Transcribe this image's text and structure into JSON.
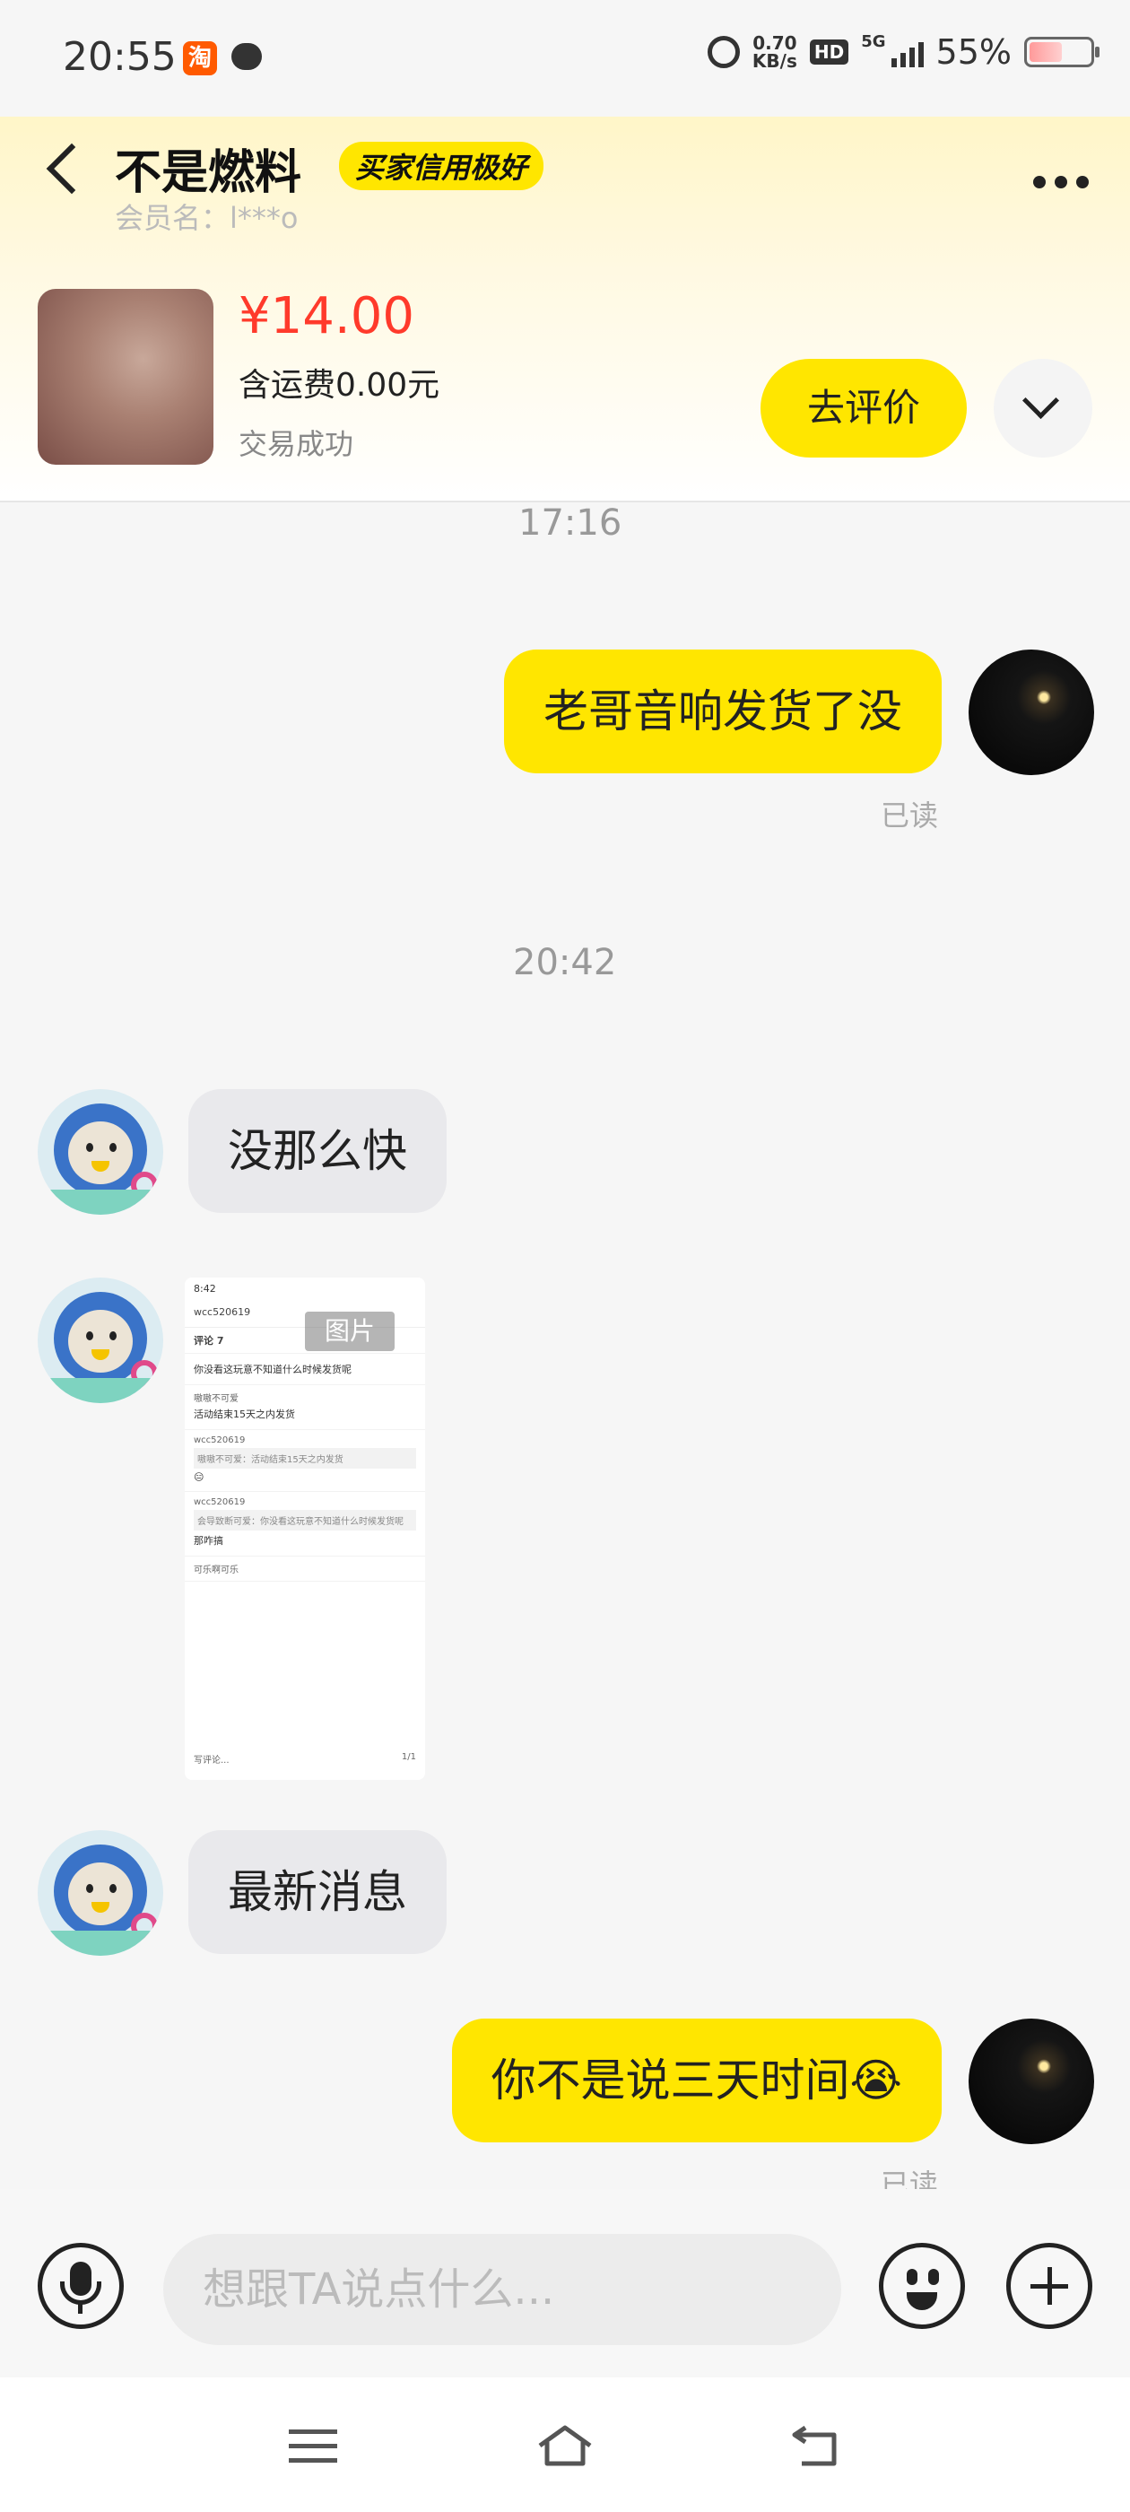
{
  "status_bar": {
    "time": "20:55",
    "taobao_badge": "淘",
    "speed_value": "0.70",
    "speed_unit": "KB/s",
    "hd": "HD",
    "network": "5G",
    "battery_percent": "55%",
    "battery_level": 0.55
  },
  "header": {
    "shop_name": "不是燃料",
    "credit_badge": "买家信用极好",
    "member_label": "会员名：l***o"
  },
  "order": {
    "price": "¥14.00",
    "shipping": "含运费0.00元",
    "status": "交易成功",
    "review_button": "去评价"
  },
  "chat": {
    "time1": "17:16",
    "msg1": "老哥音响发货了没",
    "read1": "已读",
    "time2": "20:42",
    "msg2": "没那么快",
    "image_label": "图片",
    "shared_image": {
      "clock": "8:42",
      "account": "wcc520619",
      "section": "评论 7",
      "comments": [
        {
          "name": "",
          "text": "你没看这玩意不知道什么时候发货呢"
        },
        {
          "name": "嗷嗷不可爱",
          "text": "活动结束15天之内发货"
        },
        {
          "name": "wcc520619",
          "quote": "嗷嗷不可爱",
          "quote_text": "活动结束15天之内发货",
          "text": "😑"
        },
        {
          "name": "wcc520619",
          "quote": "会导致断可爱",
          "quote_text": "你没看这玩意不知道什么时候发货呢",
          "text": "那咋搞"
        },
        {
          "name": "可乐啊可乐",
          "text": ""
        }
      ],
      "compose": "写评论...",
      "page": "1/1"
    },
    "msg3": "最新消息",
    "msg4": "你不是说三天时间😭",
    "read2": "已读"
  },
  "input": {
    "placeholder": "想跟TA说点什么..."
  },
  "icons": {
    "back": "back-chevron-icon",
    "more": "more-dots-icon",
    "expand": "chevron-down-icon",
    "mic": "microphone-icon",
    "emoji": "emoji-icon",
    "plus": "plus-icon",
    "nav_menu": "menu-icon",
    "nav_home": "home-icon",
    "nav_back": "back-icon"
  },
  "colors": {
    "accent": "#ffe600",
    "price": "#ff3a2b"
  }
}
